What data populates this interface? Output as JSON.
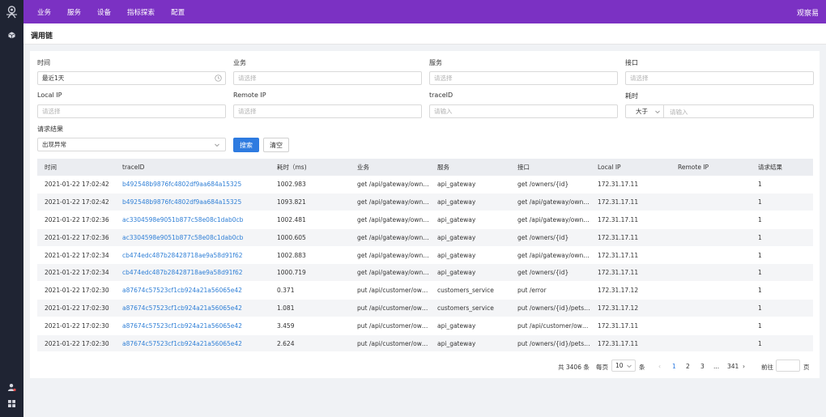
{
  "topnav": [
    "业务",
    "服务",
    "设备",
    "指标探索",
    "配置"
  ],
  "brand": "观察易",
  "page_title": "调用链",
  "filters": {
    "time_label": "时间",
    "time_value": "最近1天",
    "business_label": "业务",
    "business_placeholder": "请选择",
    "service_label": "服务",
    "service_placeholder": "请选择",
    "interface_label": "接口",
    "interface_placeholder": "请选择",
    "local_ip_label": "Local IP",
    "local_ip_placeholder": "请选择",
    "remote_ip_label": "Remote IP",
    "remote_ip_placeholder": "请选择",
    "trace_label": "traceID",
    "trace_placeholder": "请输入",
    "duration_label": "耗时",
    "duration_op": "大于",
    "duration_placeholder": "请输入",
    "result_label": "请求结果",
    "result_value": "出现异常"
  },
  "buttons": {
    "search": "搜索",
    "clear": "清空"
  },
  "table": {
    "headers": [
      "时间",
      "traceID",
      "耗时（ms)",
      "业务",
      "服务",
      "接口",
      "Local IP",
      "Remote IP",
      "请求结果"
    ],
    "rows": [
      [
        "2021-01-22 17:02:42",
        "b492548b9876fc4802df9aa684a15325",
        "1002.983",
        "get /api/gateway/owners/{id}",
        "api_gateway",
        "get /owners/{id}",
        "172.31.17.11",
        "",
        "1"
      ],
      [
        "2021-01-22 17:02:42",
        "b492548b9876fc4802df9aa684a15325",
        "1093.821",
        "get /api/gateway/owners/{id}",
        "api_gateway",
        "get /api/gateway/owners/{id}",
        "172.31.17.11",
        "",
        "1"
      ],
      [
        "2021-01-22 17:02:36",
        "ac3304598e9051b877c58e08c1dab0cb",
        "1002.481",
        "get /api/gateway/owners/{id}",
        "api_gateway",
        "get /api/gateway/owners/{id}",
        "172.31.17.11",
        "",
        "1"
      ],
      [
        "2021-01-22 17:02:36",
        "ac3304598e9051b877c58e08c1dab0cb",
        "1000.605",
        "get /api/gateway/owners/{id}",
        "api_gateway",
        "get /owners/{id}",
        "172.31.17.11",
        "",
        "1"
      ],
      [
        "2021-01-22 17:02:34",
        "cb474edc487b28428718ae9a58d91f62",
        "1002.883",
        "get /api/gateway/owners/{id}",
        "api_gateway",
        "get /api/gateway/owners/{id}",
        "172.31.17.11",
        "",
        "1"
      ],
      [
        "2021-01-22 17:02:34",
        "cb474edc487b28428718ae9a58d91f62",
        "1000.719",
        "get /api/gateway/owners/{id}",
        "api_gateway",
        "get /owners/{id}",
        "172.31.17.11",
        "",
        "1"
      ],
      [
        "2021-01-22 17:02:30",
        "a87674c57523cf1cb924a21a56065e42",
        "0.371",
        "put /api/customer/owners/{id}",
        "customers_service",
        "put /error",
        "172.31.17.12",
        "",
        "1"
      ],
      [
        "2021-01-22 17:02:30",
        "a87674c57523cf1cb924a21a56065e42",
        "1.081",
        "put /api/customer/owners/{id}",
        "customers_service",
        "put /owners/{id}/pets/{id}",
        "172.31.17.12",
        "",
        "1"
      ],
      [
        "2021-01-22 17:02:30",
        "a87674c57523cf1cb924a21a56065e42",
        "3.459",
        "put /api/customer/owners/{id}",
        "api_gateway",
        "put /api/customer/owners/{id}",
        "172.31.17.11",
        "",
        "1"
      ],
      [
        "2021-01-22 17:02:30",
        "a87674c57523cf1cb924a21a56065e42",
        "2.624",
        "put /api/customer/owners/{id}",
        "api_gateway",
        "put /owners/{id}/pets/{id}",
        "172.31.17.11",
        "",
        "1"
      ]
    ]
  },
  "pagination": {
    "total": "共 3406 条",
    "per_page_label": "每页",
    "per_page_value": "10",
    "per_page_unit": "条",
    "pages": [
      "1",
      "2",
      "3",
      "...",
      "341"
    ],
    "goto_label": "前往",
    "goto_unit": "页"
  },
  "colors": {
    "topbar": "#7b31c3",
    "sidebar": "#1f2433",
    "primary": "#2e7be0",
    "link": "#2f7fd6"
  }
}
